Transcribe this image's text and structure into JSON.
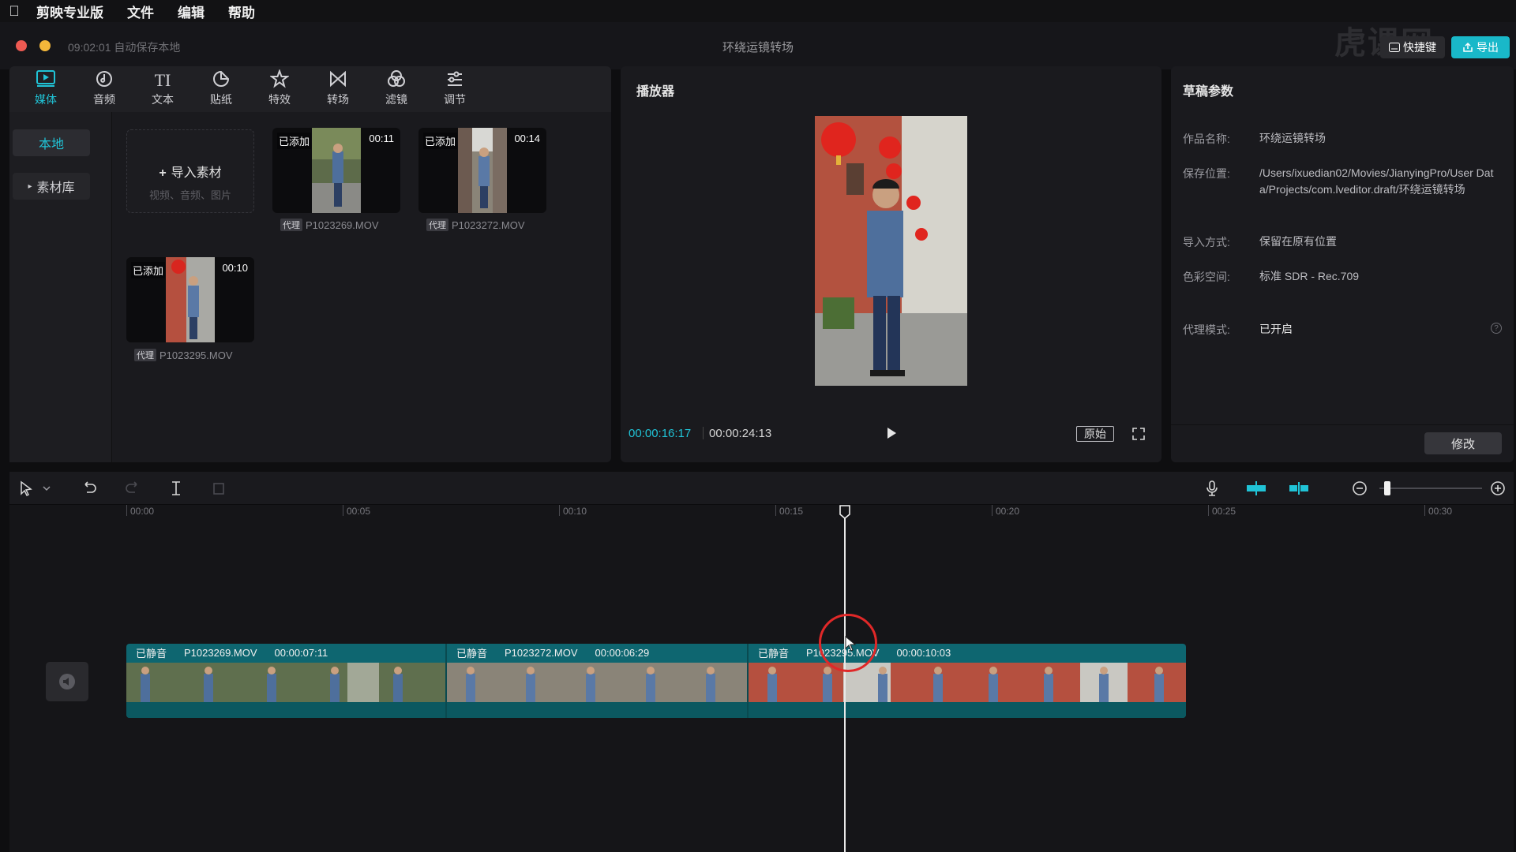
{
  "menubar": {
    "items": [
      "剪映专业版",
      "文件",
      "编辑",
      "帮助"
    ]
  },
  "window": {
    "autosave": "09:02:01 自动保存本地",
    "title": "环绕运镜转场",
    "shortcut_label": "快捷键",
    "export_label": "导出",
    "watermark": "虎课网"
  },
  "toolbar": {
    "tools": [
      {
        "label": "媒体",
        "icon": "media-icon"
      },
      {
        "label": "音频",
        "icon": "audio-icon"
      },
      {
        "label": "文本",
        "icon": "text-icon"
      },
      {
        "label": "贴纸",
        "icon": "sticker-icon"
      },
      {
        "label": "特效",
        "icon": "effects-icon"
      },
      {
        "label": "转场",
        "icon": "transition-icon"
      },
      {
        "label": "滤镜",
        "icon": "filter-icon"
      },
      {
        "label": "调节",
        "icon": "adjust-icon"
      }
    ],
    "text_glyph": "TI"
  },
  "media": {
    "nav_local": "本地",
    "nav_library": "素材库",
    "import_label": "导入素材",
    "import_hint": "视频、音频、图片",
    "added_label": "已添加",
    "proxy_label": "代理",
    "clips": [
      {
        "name": "P1023269.MOV",
        "duration": "00:11"
      },
      {
        "name": "P1023272.MOV",
        "duration": "00:14"
      },
      {
        "name": "P1023295.MOV",
        "duration": "00:10"
      }
    ]
  },
  "player": {
    "title": "播放器",
    "current_time": "00:00:16:17",
    "total_time": "00:00:24:13",
    "original_label": "原始"
  },
  "params": {
    "title": "草稿参数",
    "rows": [
      {
        "label": "作品名称:",
        "value": "环绕运镜转场"
      },
      {
        "label": "保存位置:",
        "value": "/Users/ixuedian02/Movies/JianyingPro/User Data/Projects/com.lveditor.draft/环绕运镜转场"
      },
      {
        "label": "导入方式:",
        "value": "保留在原有位置"
      },
      {
        "label": "色彩空间:",
        "value": "标准 SDR - Rec.709"
      },
      {
        "label": "代理模式:",
        "value": "已开启"
      }
    ],
    "modify_label": "修改"
  },
  "timeline": {
    "ruler": [
      "00:00",
      "00:05",
      "00:10",
      "00:15",
      "00:20",
      "00:25",
      "00:30"
    ],
    "muted_label": "已静音",
    "segments": [
      {
        "name": "P1023269.MOV",
        "duration": "00:00:07:11"
      },
      {
        "name": "P1023272.MOV",
        "duration": "00:00:06:29"
      },
      {
        "name": "P1023295.MOV",
        "duration": "00:00:10:03"
      }
    ],
    "zoom_level": 0.08
  },
  "colors": {
    "accent": "#20c3d6",
    "track": "#0e6670",
    "cursor_ring": "#e02828"
  }
}
